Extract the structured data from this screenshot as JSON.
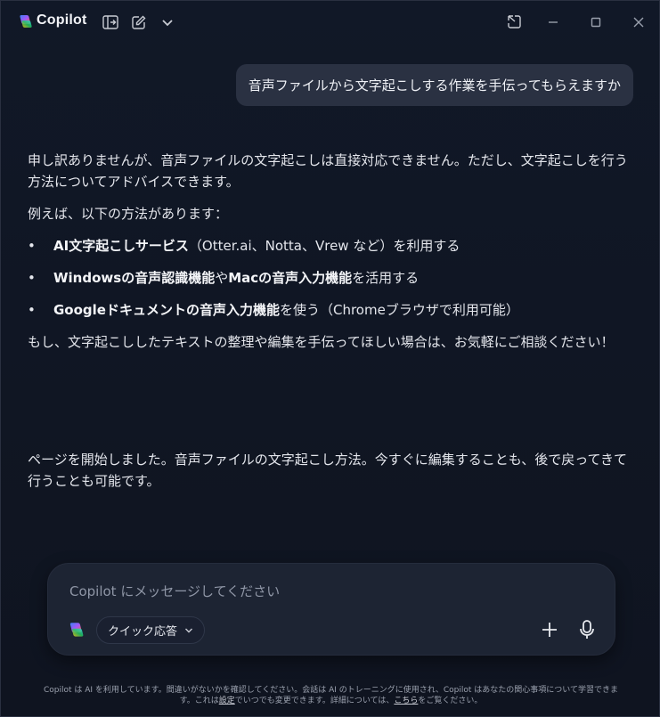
{
  "app": {
    "title": "Copilot"
  },
  "colors": {
    "background": "#0f1420",
    "bubble": "#2a3142",
    "composer": "#1d2433"
  },
  "titlebar_icons": [
    "sidebar-toggle-icon",
    "new-chat-icon",
    "chevron-down-icon",
    "pop-out-icon",
    "minimize-icon",
    "maximize-icon",
    "close-icon"
  ],
  "user_message": "音声ファイルから文字起こしする作業を手伝ってもらえますか",
  "assistant": {
    "intro": "申し訳ありませんが、音声ファイルの文字起こしは直接対応できません。ただし、文字起こしを行う方法についてアドバイスできます。",
    "examples_heading": "例えば、以下の方法があります：",
    "bullet_char": "•",
    "bullets": [
      {
        "bold1": "AI文字起こしサービス",
        "text1": "（Otter.ai、Notta、Vrew など）を利用する",
        "bold2": "",
        "text2": ""
      },
      {
        "bold1": "Windowsの音声認識機能",
        "text1": "や",
        "bold2": "Macの音声入力機能",
        "text2": "を活用する"
      },
      {
        "bold1": "Googleドキュメントの音声入力機能",
        "text1": "を使う（Chromeブラウザで利用可能）",
        "bold2": "",
        "text2": ""
      }
    ],
    "closing": "もし、文字起こししたテキストの整理や編集を手伝ってほしい場合は、お気軽にご相談ください！",
    "followup": "ページを開始しました。音声ファイルの文字起こし方法。今すぐに編集することも、後で戻ってきて行うことも可能です。"
  },
  "composer": {
    "placeholder": "Copilot にメッセージしてください",
    "value": "",
    "mode_label": "クイック応答"
  },
  "disclaimer": {
    "part1": "Copilot は AI を利用しています。間違いがないかを確認してください。会話は AI のトレーニングに使用され、Copilot はあなたの関心事項について学習できます。これは",
    "link1": "設定",
    "part2": "でいつでも変更できます。詳細については、",
    "link2": "こちら",
    "part3": "をご覧ください。"
  }
}
